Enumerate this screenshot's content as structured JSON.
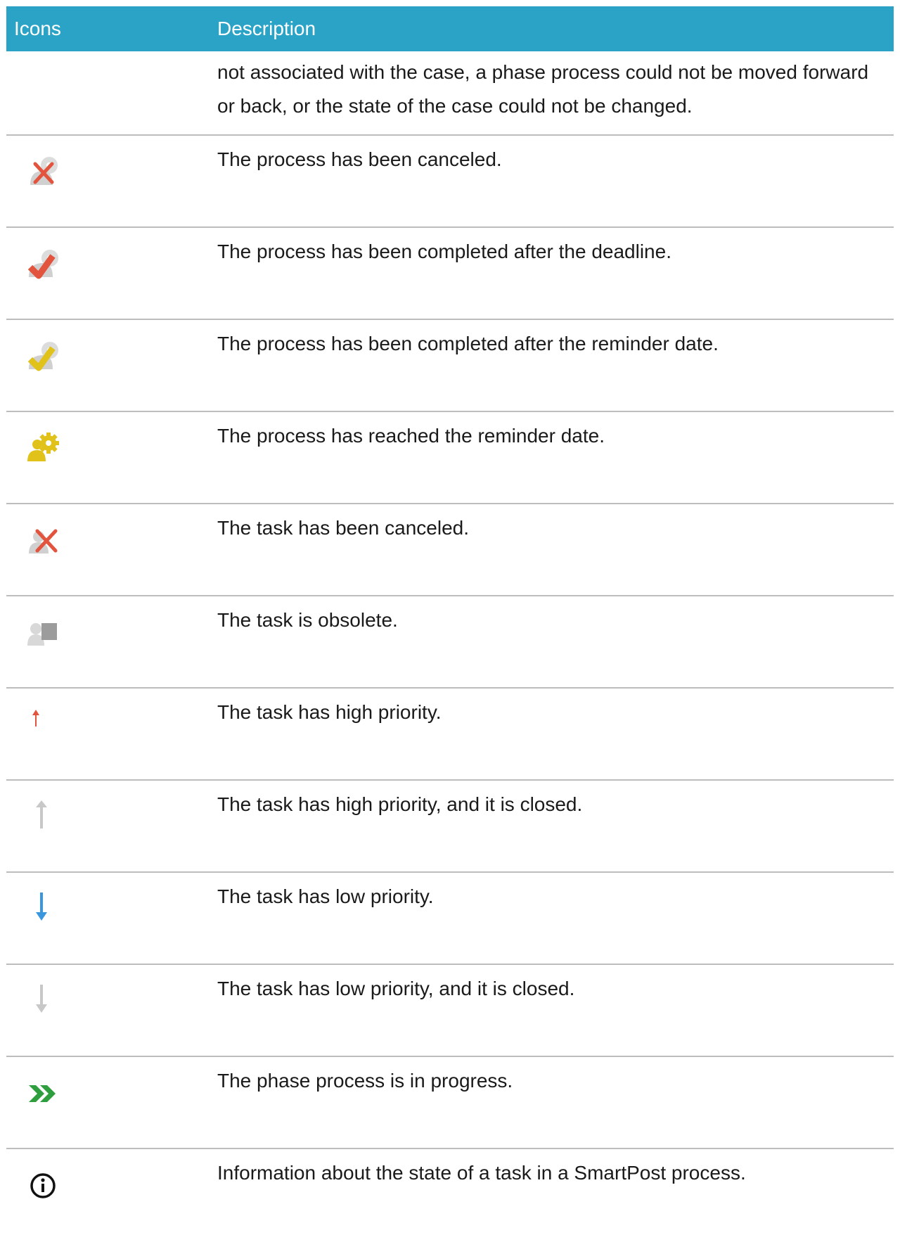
{
  "header": {
    "icons_label": "Icons",
    "description_label": "Description"
  },
  "continued_text": "not associated with the case, a phase process could not be moved forward or back, or the state of the case could not be changed.",
  "rows": [
    {
      "icon": "process-canceled-icon",
      "description": "The process has been canceled."
    },
    {
      "icon": "process-completed-after-deadline-icon",
      "description": "The process has been completed after the deadline."
    },
    {
      "icon": "process-completed-after-reminder-icon",
      "description": "The process has been completed after the reminder date."
    },
    {
      "icon": "process-reminder-reached-icon",
      "description": "The process has reached the reminder date."
    },
    {
      "icon": "task-canceled-icon",
      "description": "The task has been canceled."
    },
    {
      "icon": "task-obsolete-icon",
      "description": "The task is obsolete."
    },
    {
      "icon": "high-priority-icon",
      "description": "The task has high priority."
    },
    {
      "icon": "high-priority-closed-icon",
      "description": "The task has high priority, and it is closed."
    },
    {
      "icon": "low-priority-icon",
      "description": "The task has low priority."
    },
    {
      "icon": "low-priority-closed-icon",
      "description": "The task has low priority, and it is closed."
    },
    {
      "icon": "phase-in-progress-icon",
      "description": "The phase process is in progress."
    },
    {
      "icon": "info-icon",
      "description": "Information about the state of a task in a SmartPost process."
    }
  ],
  "colors": {
    "header_bg": "#2aa3c7",
    "header_text": "#ffffff",
    "divider": "#bdbdbd",
    "red": "#e2543e",
    "yellow": "#e0c21a",
    "gray": "#d4d4d4",
    "blue": "#3b97dd",
    "green": "#2e9e3e"
  }
}
